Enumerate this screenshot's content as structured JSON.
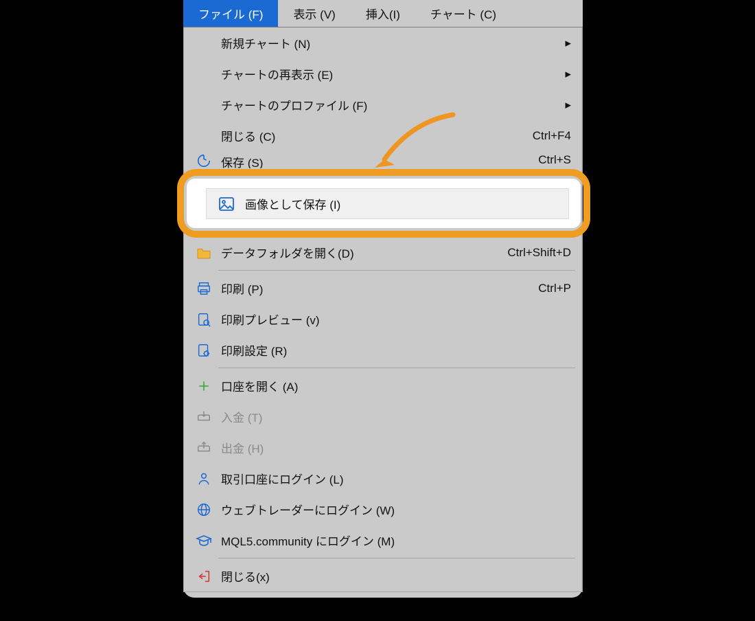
{
  "menubar": {
    "items": [
      {
        "label": "ファイル (F)",
        "active": true
      },
      {
        "label": "表示 (V)",
        "active": false
      },
      {
        "label": "挿入(I)",
        "active": false
      },
      {
        "label": "チャート (C)",
        "active": false
      }
    ]
  },
  "dropdown": {
    "groups": [
      [
        {
          "icon": "",
          "label": "新規チャート (N)",
          "shortcut": "",
          "submenu": true
        },
        {
          "icon": "",
          "label": "チャートの再表示 (E)",
          "shortcut": "",
          "submenu": true
        },
        {
          "icon": "",
          "label": "チャートのプロファイル (F)",
          "shortcut": "",
          "submenu": true
        },
        {
          "icon": "",
          "label": "閉じる (C)",
          "shortcut": "Ctrl+F4"
        },
        {
          "icon": "save-icon",
          "label": "保存 (S)",
          "shortcut": "Ctrl+S",
          "clipped": true
        }
      ],
      [
        {
          "icon": "folder-icon",
          "label": "データフォルダを開く(D)",
          "shortcut": "Ctrl+Shift+D"
        }
      ],
      [
        {
          "icon": "printer-icon",
          "label": "印刷 (P)",
          "shortcut": "Ctrl+P"
        },
        {
          "icon": "preview-icon",
          "label": "印刷プレビュー (v)",
          "shortcut": ""
        },
        {
          "icon": "gear-icon",
          "label": "印刷設定 (R)",
          "shortcut": ""
        }
      ],
      [
        {
          "icon": "plus-icon",
          "label": "口座を開く (A)"
        },
        {
          "icon": "deposit-icon",
          "label": "入金 (T)",
          "disabled": true
        },
        {
          "icon": "withdraw-icon",
          "label": "出金 (H)",
          "disabled": true
        },
        {
          "icon": "person-icon",
          "label": "取引口座にログイン (L)"
        },
        {
          "icon": "globe-icon",
          "label": "ウェブトレーダーにログイン (W)"
        },
        {
          "icon": "cap-icon",
          "label": "MQL5.community にログイン (M)"
        }
      ],
      [
        {
          "icon": "exit-icon",
          "label": "閉じる(x)"
        }
      ]
    ]
  },
  "highlight": {
    "icon": "image-icon",
    "label": "画像として保存 (I)"
  }
}
